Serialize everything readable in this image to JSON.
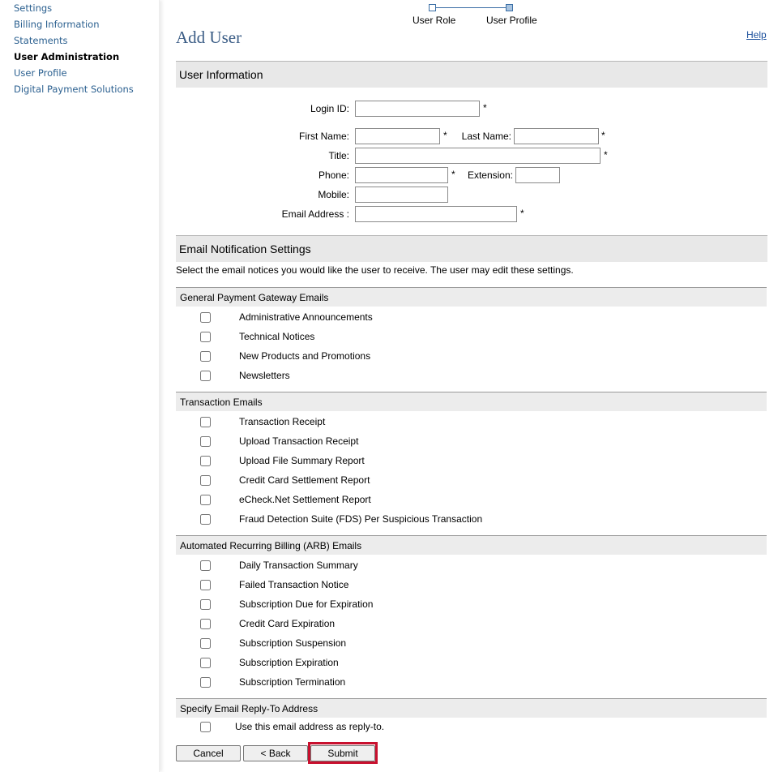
{
  "sidebar": {
    "items": [
      {
        "label": "Settings",
        "active": false
      },
      {
        "label": "Billing Information",
        "active": false
      },
      {
        "label": "Statements",
        "active": false
      },
      {
        "label": "User Administration",
        "active": true
      },
      {
        "label": "User Profile",
        "active": false
      },
      {
        "label": "Digital Payment Solutions",
        "active": false
      }
    ]
  },
  "stepper": {
    "steps": [
      "User Role",
      "User Profile"
    ],
    "current_step": 2
  },
  "page": {
    "title": "Add User",
    "help": "Help"
  },
  "user_info": {
    "header": "User Information",
    "login_id": {
      "label": "Login ID:",
      "value": "",
      "required": "*"
    },
    "first_name": {
      "label": "First Name:",
      "value": "",
      "required": "*"
    },
    "last_name": {
      "label": "Last Name:",
      "value": "",
      "required": "*"
    },
    "title": {
      "label": "Title:",
      "value": "",
      "required": "*"
    },
    "phone": {
      "label": "Phone:",
      "value": "",
      "required": "*"
    },
    "extension": {
      "label": "Extension:",
      "value": ""
    },
    "mobile": {
      "label": "Mobile:",
      "value": ""
    },
    "email": {
      "label": "Email Address :",
      "value": "",
      "required": "*"
    }
  },
  "email_settings": {
    "header": "Email Notification Settings",
    "description": "Select the email notices you would like the user to receive. The user may edit these settings.",
    "groups": [
      {
        "title": "General Payment Gateway Emails",
        "items": [
          "Administrative Announcements",
          "Technical Notices",
          "New Products and Promotions",
          "Newsletters"
        ]
      },
      {
        "title": "Transaction Emails",
        "items": [
          "Transaction Receipt",
          "Upload Transaction Receipt",
          "Upload File Summary Report",
          "Credit Card Settlement Report",
          "eCheck.Net Settlement Report",
          "Fraud Detection Suite (FDS) Per Suspicious Transaction"
        ]
      },
      {
        "title": "Automated Recurring Billing (ARB) Emails",
        "items": [
          "Daily Transaction Summary",
          "Failed Transaction Notice",
          "Subscription Due for Expiration",
          "Credit Card Expiration",
          "Subscription Suspension",
          "Subscription Expiration",
          "Subscription Termination"
        ]
      },
      {
        "title": "Specify Email Reply-To Address",
        "items": [
          "Use this email address as reply-to."
        ]
      }
    ]
  },
  "buttons": {
    "cancel": "Cancel",
    "back": "< Back",
    "submit": "Submit"
  },
  "colors": {
    "highlight": "#c8102e",
    "link": "#2a5f8f",
    "title": "#3a5c85"
  }
}
